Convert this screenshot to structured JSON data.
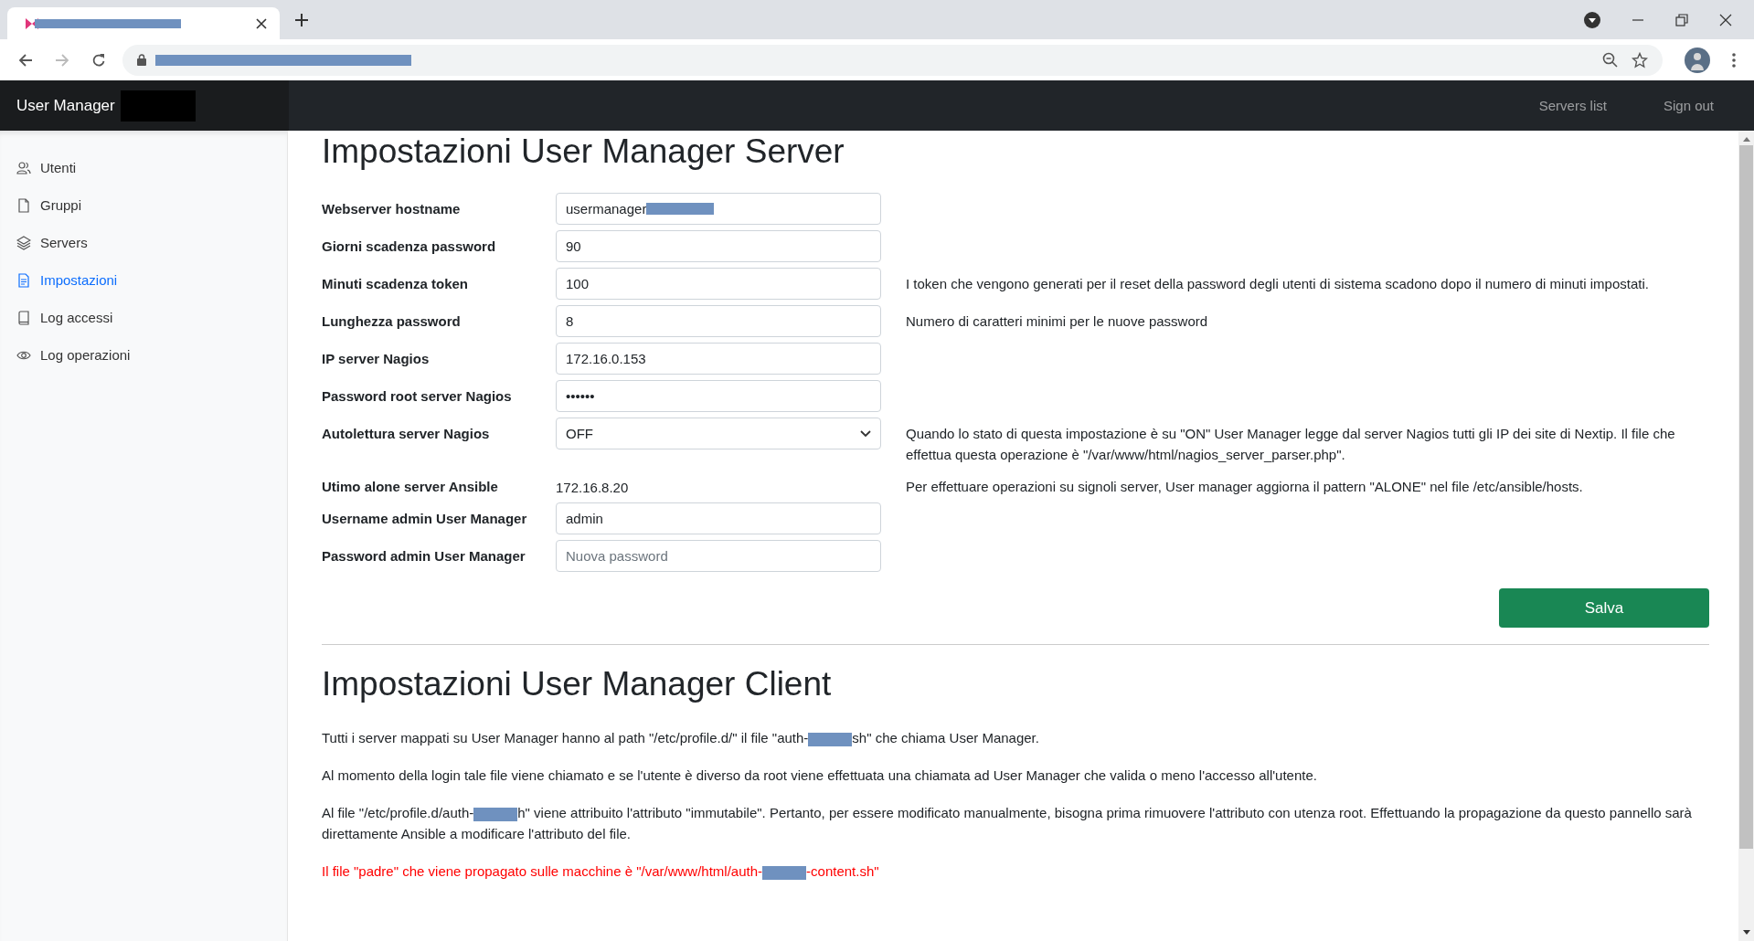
{
  "navbar": {
    "brand": "User Manager",
    "links": [
      "Servers list",
      "Sign out"
    ]
  },
  "sidebar": {
    "items": [
      {
        "label": "Utenti",
        "selected": false
      },
      {
        "label": "Gruppi",
        "selected": false
      },
      {
        "label": "Servers",
        "selected": false
      },
      {
        "label": "Impostazioni",
        "selected": true
      },
      {
        "label": "Log accessi",
        "selected": false
      },
      {
        "label": "Log operazioni",
        "selected": false
      }
    ]
  },
  "server_settings": {
    "title": "Impostazioni User Manager Server",
    "fields": [
      {
        "label": "Webserver hostname",
        "kind": "input",
        "value": [
          {
            "kind": "text",
            "text": "usermanager"
          },
          {
            "kind": "redacted"
          }
        ]
      },
      {
        "label": "Giorni scadenza password",
        "kind": "input",
        "value": [
          {
            "kind": "text",
            "text": "90"
          }
        ]
      },
      {
        "label": "Minuti scadenza token",
        "kind": "input",
        "value": [
          {
            "kind": "text",
            "text": "100"
          }
        ],
        "help": "I token che vengono generati per il reset della password degli utenti di sistema scadono dopo il numero di minuti impostati."
      },
      {
        "label": "Lunghezza password",
        "kind": "input",
        "value": [
          {
            "kind": "text",
            "text": "8"
          }
        ],
        "help": "Numero di caratteri minimi per le nuove password"
      },
      {
        "label": "IP server Nagios",
        "kind": "input",
        "value": [
          {
            "kind": "text",
            "text": "172.16.0.153"
          }
        ]
      },
      {
        "label": "Password root server Nagios",
        "kind": "input",
        "value": [
          {
            "kind": "text",
            "text": "••••••"
          }
        ]
      },
      {
        "label": "Autolettura server Nagios",
        "kind": "select",
        "value": [
          {
            "kind": "text",
            "text": "OFF"
          }
        ],
        "help": "Quando lo stato di questa impostazione è su \"ON\" User Manager legge dal server Nagios tutti gli IP dei site di Nextip. Il file che effettua questa operazione è \"/var/www/html/nagios_server_parser.php\"."
      },
      {
        "label": "Utimo alone server Ansible",
        "kind": "static",
        "value": [
          {
            "kind": "text",
            "text": "172.16.8.20"
          }
        ],
        "help": "Per effettuare operazioni su signoli server, User manager aggiorna il pattern \"ALONE\" nel file /etc/ansible/hosts."
      },
      {
        "label": "Username admin User Manager",
        "kind": "input",
        "value": [
          {
            "kind": "text",
            "text": "admin"
          }
        ]
      },
      {
        "label": "Password admin User Manager",
        "kind": "input",
        "placeholder": "Nuova password"
      }
    ],
    "save_button": "Salva"
  },
  "client_settings": {
    "title": "Impostazioni User Manager Client",
    "paragraphs": [
      {
        "kind": "normal",
        "parts": [
          {
            "kind": "text",
            "text": "Tutti i server mappati su User Manager hanno al path \"/etc/profile.d/\" il file \"auth-"
          },
          {
            "kind": "redacted"
          },
          {
            "kind": "text",
            "text": "sh\" che chiama User Manager."
          }
        ]
      },
      {
        "kind": "normal",
        "parts": [
          {
            "kind": "text",
            "text": "Al momento della login tale file viene chiamato e se l'utente è diverso da root viene effettuata una chiamata ad User Manager che valida o meno l'accesso all'utente."
          }
        ]
      },
      {
        "kind": "normal",
        "parts": [
          {
            "kind": "text",
            "text": "Al file \"/etc/profile.d/auth-"
          },
          {
            "kind": "redacted"
          },
          {
            "kind": "text",
            "text": "h\" viene attribuito l'attributo \"immutabile\". Pertanto, per essere modificato manualmente, bisogna prima rimuovere l'attributo con utenza root. Effettuando la propagazione da questo pannello sarà direttamente Ansible a modificare l'attributo del file."
          }
        ]
      },
      {
        "kind": "warning",
        "parts": [
          {
            "kind": "text",
            "text": "Il file \"padre\" che viene propagato sulle macchine è \"/var/www/html/auth-"
          },
          {
            "kind": "redacted"
          },
          {
            "kind": "text",
            "text": "-content.sh\""
          }
        ]
      }
    ]
  }
}
